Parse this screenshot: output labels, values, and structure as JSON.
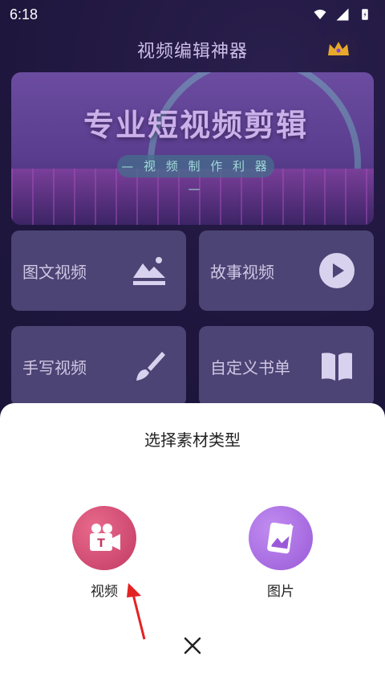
{
  "status_bar": {
    "time": "6:18"
  },
  "header": {
    "title": "视频编辑神器",
    "crown_icon": "crown-icon"
  },
  "banner": {
    "title": "专业短视频剪辑",
    "subtitle": "— 视 频 制 作 利 器 —"
  },
  "cards": [
    {
      "label": "图文视频",
      "icon": "image-icon"
    },
    {
      "label": "故事视频",
      "icon": "play-icon"
    },
    {
      "label": "手写视频",
      "icon": "brush-icon"
    },
    {
      "label": "自定义书单",
      "icon": "book-icon"
    }
  ],
  "sheet": {
    "title": "选择素材类型",
    "options": [
      {
        "label": "视频",
        "icon": "video-camera-icon",
        "color": "#d2486a"
      },
      {
        "label": "图片",
        "icon": "picture-icon",
        "color": "#a56be0"
      }
    ],
    "close_icon": "close-icon"
  }
}
